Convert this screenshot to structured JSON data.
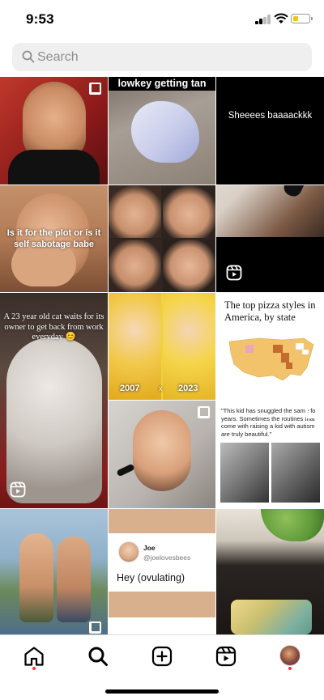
{
  "status_bar": {
    "time": "9:53",
    "battery_level": 0.3,
    "battery_color": "#f1c40f"
  },
  "search": {
    "placeholder": "Search"
  },
  "grid": {
    "tiles": [
      {
        "id": "tile-1",
        "kind": "photo",
        "caption": "",
        "badge": "multi"
      },
      {
        "id": "tile-2",
        "kind": "photo",
        "caption": "lowkey getting tan",
        "badge": "none"
      },
      {
        "id": "tile-3",
        "kind": "video",
        "caption": "Sheeees baaaackkk",
        "badge": "none"
      },
      {
        "id": "tile-4",
        "kind": "video",
        "caption": "Is it for the plot or is it self sabotage babe",
        "badge": "none"
      },
      {
        "id": "tile-5",
        "kind": "photo",
        "caption": "",
        "badge": "none"
      },
      {
        "id": "tile-6",
        "kind": "reel",
        "caption": "",
        "badge": "reel"
      },
      {
        "id": "tile-7",
        "kind": "reel",
        "caption": "A 23 year old cat waits for its owner to get back from work everyday 😊",
        "badge": "reel"
      },
      {
        "id": "tile-8",
        "kind": "photo",
        "caption": "",
        "badge": "none",
        "labels": [
          "2007",
          "x",
          "2023"
        ]
      },
      {
        "id": "tile-9",
        "kind": "article",
        "caption": "The top pizza styles in America, by state",
        "badge": "none"
      },
      {
        "id": "tile-10",
        "kind": "photo",
        "caption": "",
        "badge": "multi"
      },
      {
        "id": "tile-11",
        "kind": "quote",
        "caption": "\"This kid has snuggled the same for years. Sometimes the routines that come with raising a kid with autism are truly beautiful.\"",
        "badge": "multi"
      },
      {
        "id": "tile-12",
        "kind": "photo",
        "caption": "",
        "badge": "multi"
      },
      {
        "id": "tile-13",
        "kind": "tweet",
        "caption": "",
        "badge": "none",
        "tweet": {
          "name": "Joe",
          "handle": "@joelovesbees",
          "text": "Hey (ovulating)"
        }
      },
      {
        "id": "tile-14",
        "kind": "photo",
        "caption": "",
        "badge": "none"
      }
    ]
  },
  "nav": {
    "items": [
      "home-icon",
      "search-icon",
      "create-icon",
      "reels-icon",
      "profile-icon"
    ],
    "active": "search-icon",
    "notification_color": "#ff3040"
  }
}
